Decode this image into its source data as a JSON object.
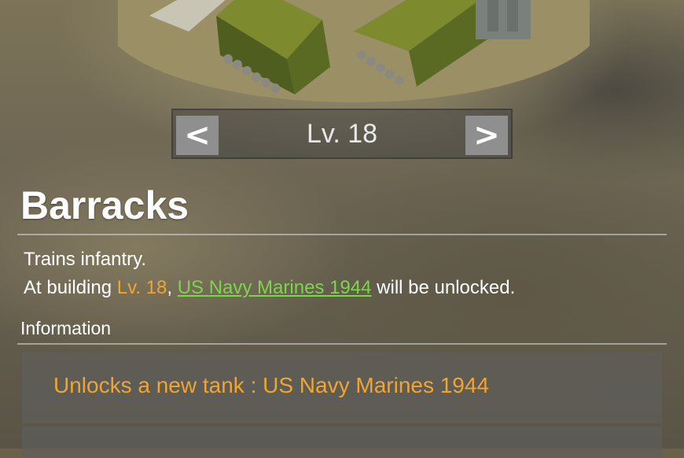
{
  "level_selector": {
    "prev_label": "<",
    "level_text": "Lv. 18",
    "next_label": ">"
  },
  "building": {
    "name": "Barracks",
    "description": "Trains infantry.",
    "unlock_prefix": "At building ",
    "unlock_level": "Lv. 18",
    "unlock_sep": ", ",
    "unlock_item": "US Navy Marines 1944",
    "unlock_suffix": " will be unlocked."
  },
  "information": {
    "label": "Information",
    "rows": [
      {
        "text": "Unlocks a new tank : US Navy Marines 1944"
      }
    ]
  },
  "colors": {
    "highlight_orange": "#f1a531",
    "link_green": "#7bd64a"
  }
}
